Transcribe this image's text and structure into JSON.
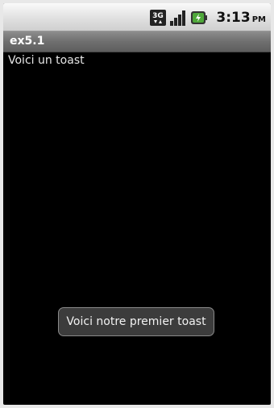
{
  "status_bar": {
    "network_label": "3G",
    "time": "3:13",
    "ampm": "PM",
    "icons": [
      "3g-data-icon",
      "signal-strength-icon",
      "battery-charging-icon"
    ]
  },
  "title_bar": {
    "title": "ex5.1"
  },
  "content": {
    "text": "Voici un toast"
  },
  "toast": {
    "message": "Voici notre premier toast"
  },
  "colors": {
    "background": "#000000",
    "title_bar": "#6f6f6f",
    "status_bar": "#e0e0e0",
    "toast_bg": "#3c3c3c"
  }
}
